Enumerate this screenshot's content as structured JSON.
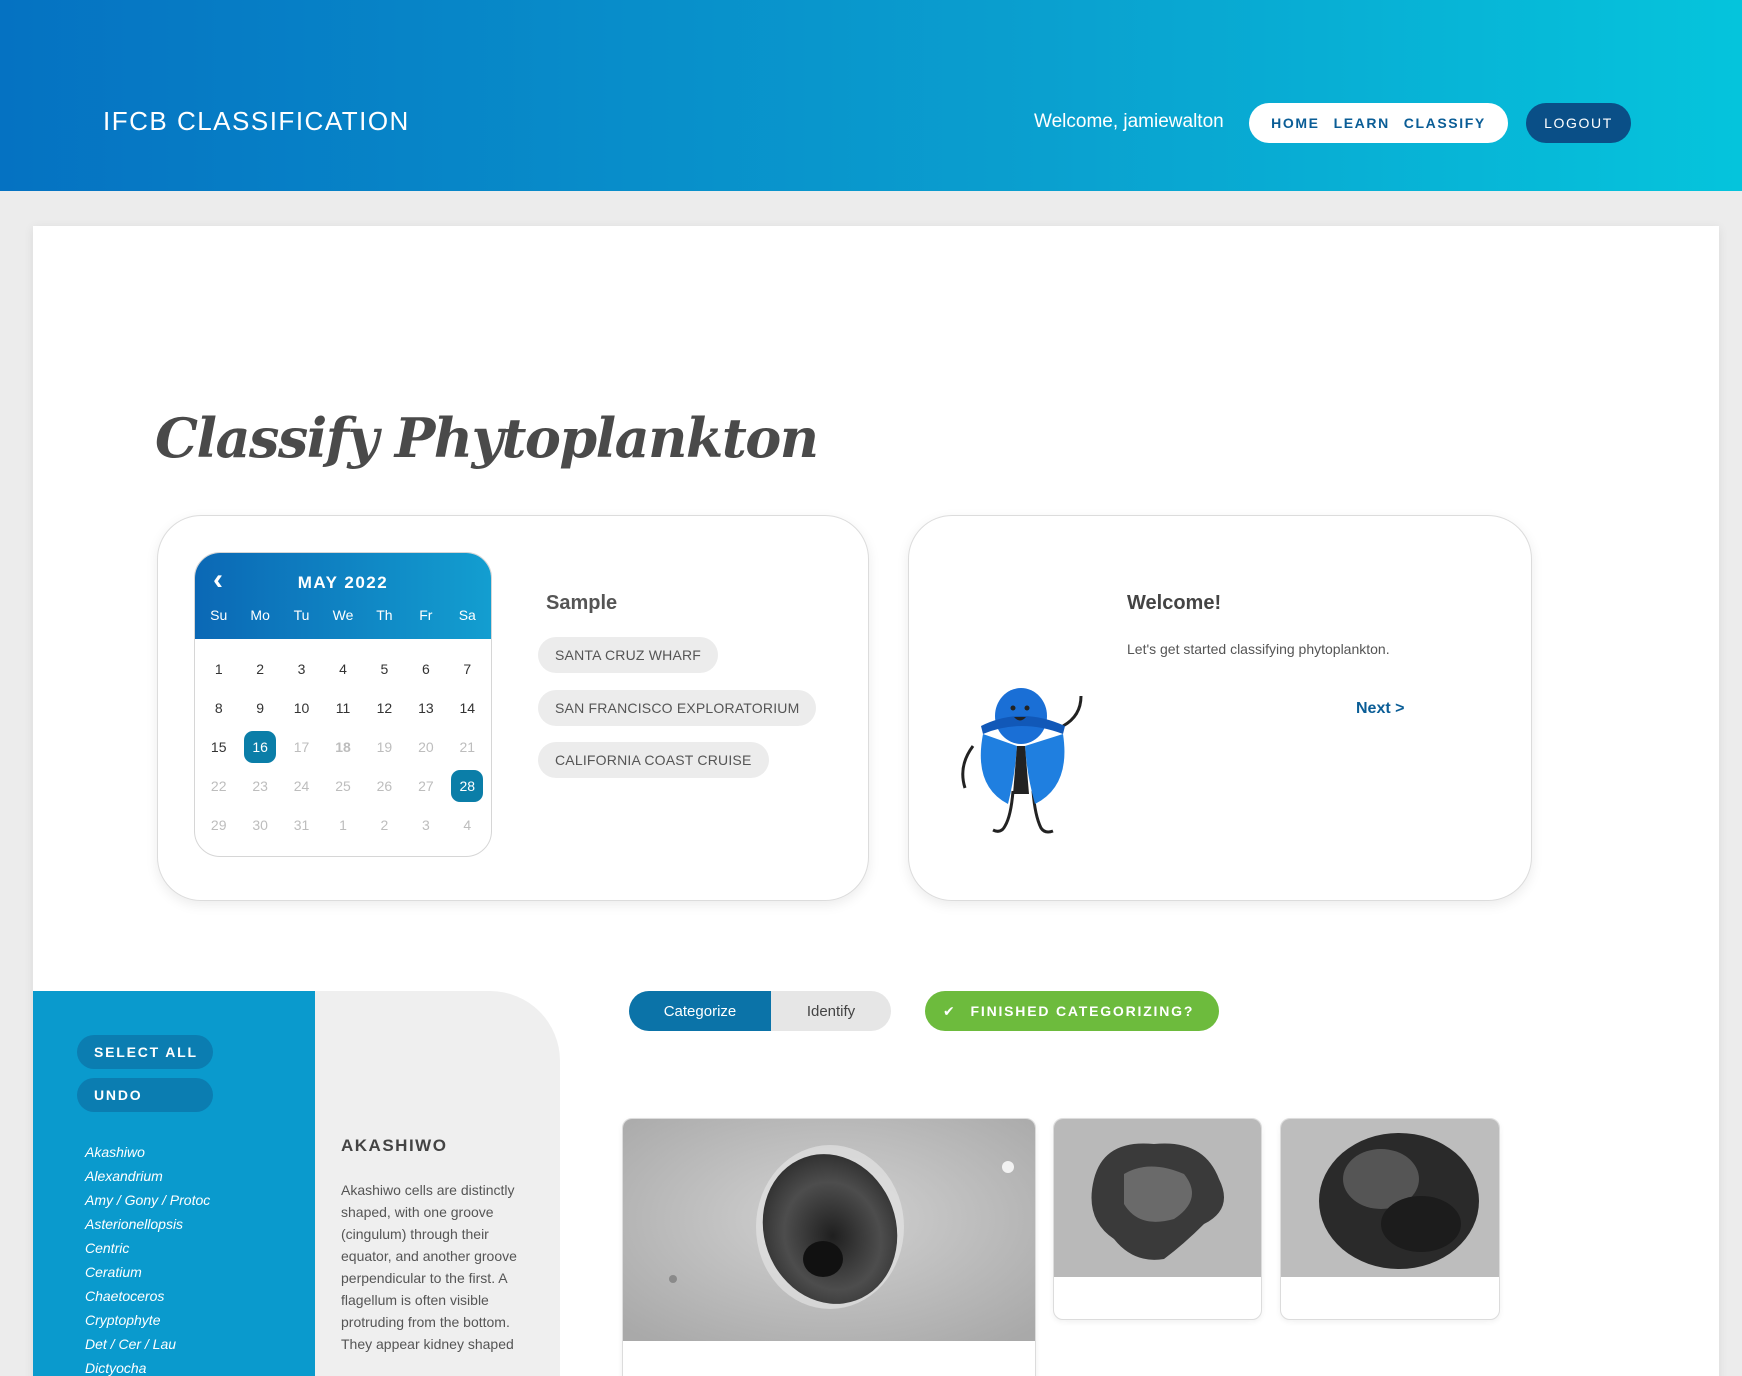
{
  "header": {
    "brand": "IFCB CLASSIFICATION",
    "welcome": "Welcome, jamiewalton",
    "nav": [
      "HOME",
      "LEARN",
      "CLASSIFY"
    ],
    "logout": "LOGOUT"
  },
  "page": {
    "title": "Classify Phytoplankton"
  },
  "calendar": {
    "month": "MAY 2022",
    "back_icon": "chevron-left-icon",
    "weekdays": [
      "Su",
      "Mo",
      "Tu",
      "We",
      "Th",
      "Fr",
      "Sa"
    ],
    "days": [
      {
        "d": "1"
      },
      {
        "d": "2"
      },
      {
        "d": "3"
      },
      {
        "d": "4"
      },
      {
        "d": "5"
      },
      {
        "d": "6"
      },
      {
        "d": "7"
      },
      {
        "d": "8"
      },
      {
        "d": "9"
      },
      {
        "d": "10"
      },
      {
        "d": "11"
      },
      {
        "d": "12"
      },
      {
        "d": "13"
      },
      {
        "d": "14"
      },
      {
        "d": "15"
      },
      {
        "d": "16",
        "selected": true
      },
      {
        "d": "17",
        "muted": true
      },
      {
        "d": "18",
        "muted": true,
        "bold": true
      },
      {
        "d": "19",
        "muted": true
      },
      {
        "d": "20",
        "muted": true
      },
      {
        "d": "21",
        "muted": true
      },
      {
        "d": "22",
        "muted": true
      },
      {
        "d": "23",
        "muted": true
      },
      {
        "d": "24",
        "muted": true
      },
      {
        "d": "25",
        "muted": true
      },
      {
        "d": "26",
        "muted": true
      },
      {
        "d": "27",
        "muted": true
      },
      {
        "d": "28",
        "selected": true
      },
      {
        "d": "29",
        "muted": true
      },
      {
        "d": "30",
        "muted": true
      },
      {
        "d": "31",
        "muted": true
      },
      {
        "d": "1",
        "muted": true
      },
      {
        "d": "2",
        "muted": true
      },
      {
        "d": "3",
        "muted": true
      },
      {
        "d": "4",
        "muted": true
      }
    ]
  },
  "sample": {
    "title": "Sample",
    "options": [
      "SANTA CRUZ WHARF",
      "SAN FRANCISCO EXPLORATORIUM",
      "CALIFORNIA COAST CRUISE"
    ]
  },
  "welcome_panel": {
    "title": "Welcome!",
    "text": "Let's get started classifying phytoplankton.",
    "next": "Next >"
  },
  "sidebar": {
    "select_all": "SELECT ALL",
    "undo": "UNDO",
    "taxa": [
      "Akashiwo",
      "Alexandrium",
      "Amy / Gony / Protoc",
      "Asterionellopsis",
      "Centric",
      "Ceratium",
      "Chaetoceros",
      "Cryptophyte",
      "Det / Cer / Lau",
      "Dictyocha"
    ]
  },
  "description": {
    "title": "AKASHIWO",
    "text": "Akashiwo cells are distinctly shaped, with one groove (cingulum) through their equator, and another groove perpendicular to the first. A flagellum is often visible protruding from the bottom. They appear kidney shaped"
  },
  "mode_toggle": {
    "active": "Categorize",
    "inactive": "Identify"
  },
  "finished": {
    "label": "FINISHED CATEGORIZING?",
    "icon": "check-icon"
  },
  "colors": {
    "header_start": "#0572c2",
    "header_end": "#05c4dc",
    "accent": "#0b73a8",
    "success": "#6dbb3d",
    "sidebar": "#0a9acd"
  }
}
